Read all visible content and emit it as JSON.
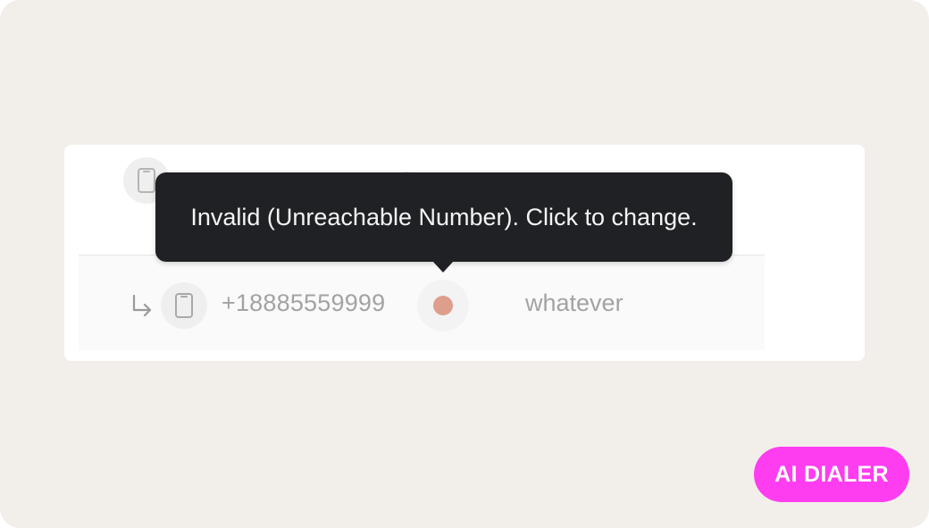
{
  "contact_rows": [
    {
      "type": "mobile-phone-icon"
    },
    {
      "type": "mobile-phone-icon",
      "indicator": "sub-arrow-icon",
      "phone_number": "+18885559999",
      "status_color": "#de9e8c",
      "label": "whatever"
    }
  ],
  "tooltip": {
    "text": "Invalid (Unreachable Number). Click to change."
  },
  "badge": {
    "text": "AI DIALER",
    "color": "#ff3df0"
  },
  "colors": {
    "background": "#f2efeb",
    "tooltip_bg": "#1f2124",
    "muted_text": "#a3a3a3"
  }
}
